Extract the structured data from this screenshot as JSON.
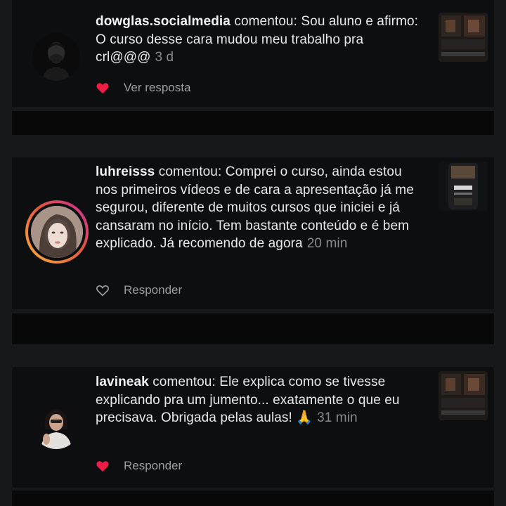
{
  "comments": [
    {
      "username": "dowglas.socialmedia",
      "verb": "comentou:",
      "text": "Sou aluno e afirmo: O curso desse cara mudou meu trabalho pra crl@@@",
      "time": "3 d",
      "action_label": "Ver resposta",
      "liked": true
    },
    {
      "username": "luhreisss",
      "verb": "comentou:",
      "text": "Comprei o curso, ainda estou nos primeiros vídeos e de cara a apresentação já me segurou, diferente de muitos cursos que iniciei e já cansaram no início.  Tem bastante conteúdo e é bem explicado. Já recomendo de agora",
      "time": "20 min",
      "action_label": "Responder",
      "liked": false
    },
    {
      "username": "lavineak",
      "verb": "comentou:",
      "text": "Ele explica como se tivesse explicando pra um jumento... exatamente o que eu precisava. Obrigada pelas aulas! 🙏",
      "time": "31 min",
      "action_label": "Responder",
      "liked": true
    }
  ],
  "icons": {
    "heart_filled": "heart-filled-icon",
    "heart_outline": "heart-outline-icon"
  },
  "colors": {
    "like_red": "#ee1d45",
    "story_ring_start": "#f9b236",
    "story_ring_end": "#c72c9e"
  }
}
